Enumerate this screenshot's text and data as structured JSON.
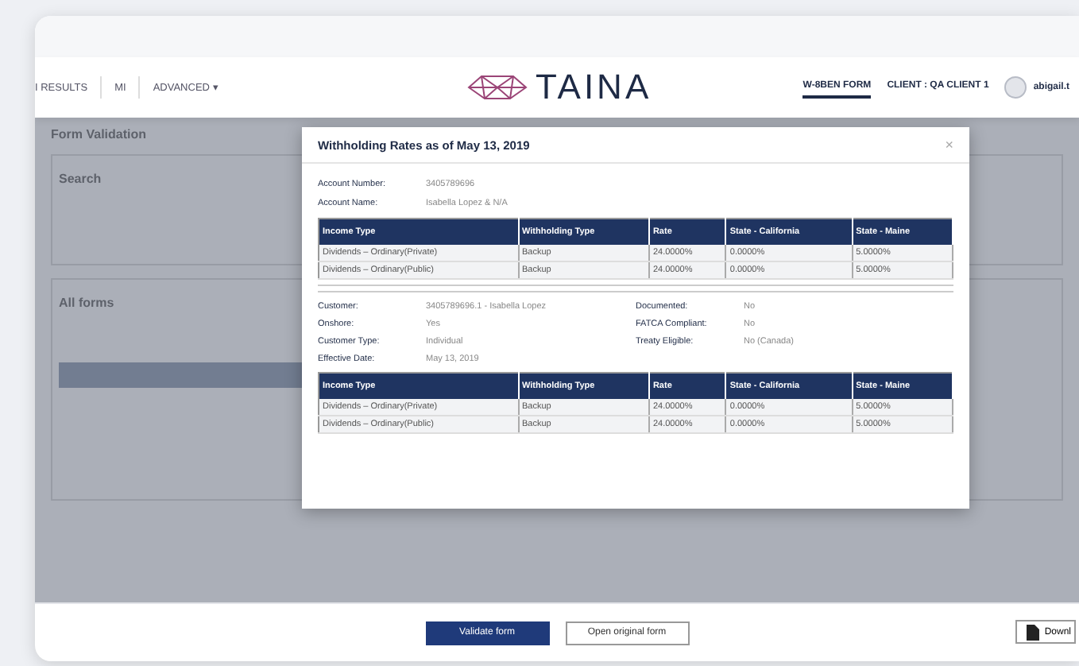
{
  "nav": {
    "items": [
      {
        "label": "I RESULTS"
      },
      {
        "label": "MI"
      },
      {
        "label": "ADVANCED ▾"
      }
    ],
    "logo": "TAINA",
    "right_items": [
      {
        "label": "W-8BEN FORM",
        "selected": true
      },
      {
        "label": "CLIENT : QA CLIENT 1",
        "selected": false
      }
    ],
    "user": "abigail.t"
  },
  "background": {
    "title": "Form Validation",
    "search_title": "Search",
    "list_title": "All forms"
  },
  "modal": {
    "title": "Withholding Rates as of May 13, 2019",
    "close": "×",
    "account": [
      {
        "label": "Account Number:",
        "value": "3405789696"
      },
      {
        "label": "Account Name:",
        "value": "Isabella Lopez & N/A"
      }
    ],
    "columns1": [
      "Income Type",
      "Withholding Type",
      "Rate",
      "State - California",
      "State - Maine"
    ],
    "table1": [
      [
        "Dividends – Ordinary(Private)",
        "Backup",
        "24.0000%",
        "0.0000%",
        "5.0000%"
      ],
      [
        "Dividends – Ordinary(Public)",
        "Backup",
        "24.0000%",
        "0.0000%",
        "5.0000%"
      ]
    ],
    "customer_left": [
      {
        "label": "Customer:",
        "value": "3405789696.1 - Isabella Lopez"
      },
      {
        "label": "Onshore:",
        "value": "Yes"
      },
      {
        "label": "Customer Type:",
        "value": "Individual"
      },
      {
        "label": "Effective Date:",
        "value": "May 13, 2019"
      }
    ],
    "customer_right": [
      {
        "label": "Documented:",
        "value": "No"
      },
      {
        "label": "FATCA Compliant:",
        "value": "No"
      },
      {
        "label": "Treaty Eligible:",
        "value": "No (Canada)"
      }
    ],
    "columns2": [
      "Income Type",
      "Withholding Type",
      "Rate",
      "State - California",
      "State - Maine"
    ],
    "table2": [
      [
        "Dividends – Ordinary(Private)",
        "Backup",
        "24.0000%",
        "0.0000%",
        "5.0000%"
      ],
      [
        "Dividends – Ordinary(Public)",
        "Backup",
        "24.0000%",
        "0.0000%",
        "5.0000%"
      ]
    ]
  },
  "footer": {
    "primary": "Validate form",
    "secondary": "Open original form",
    "download": "Downl"
  }
}
